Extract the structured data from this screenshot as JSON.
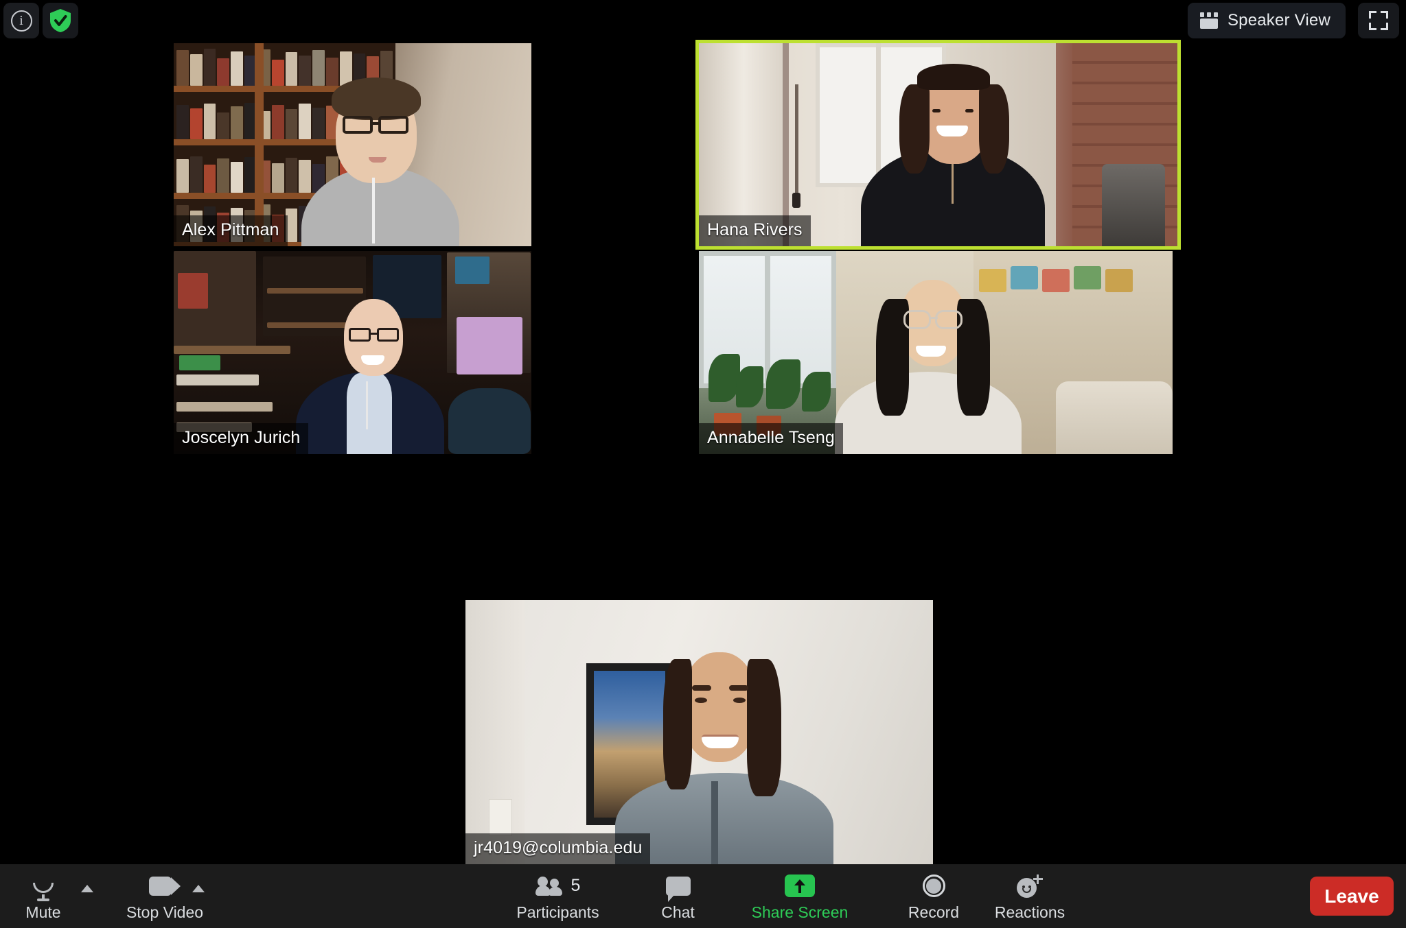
{
  "app": {
    "name": "Zoom Meeting",
    "background_color": "#000000",
    "toolbar_color": "#1c1c1c"
  },
  "topbar": {
    "info_icon": "info-icon",
    "info_glyph": "i",
    "encryption_icon": "shield-check-icon",
    "encryption_color": "#2ecc57",
    "view_button": {
      "label": "Speaker View",
      "icon": "grid-layout-icon"
    },
    "fullscreen_button": {
      "icon": "fullscreen-expand-icon",
      "label": ""
    }
  },
  "gallery": {
    "layout": "gallery-view",
    "active_speaker_border_color": "#bde031",
    "participants": [
      {
        "id": "alex",
        "name": "Alex Pittman",
        "active_speaker": false,
        "scene": "bookshelf office"
      },
      {
        "id": "hana",
        "name": "Hana Rivers",
        "active_speaker": true,
        "scene": "apartment window and brick wall"
      },
      {
        "id": "joscelyn",
        "name": "Joscelyn Jurich",
        "active_speaker": false,
        "scene": "cluttered home study"
      },
      {
        "id": "annabelle",
        "name": "Annabelle Tseng",
        "active_speaker": false,
        "scene": "window with houseplants"
      },
      {
        "id": "jr4019",
        "name": "jr4019@columbia.edu",
        "active_speaker": false,
        "scene": "white wall with framed picture"
      }
    ]
  },
  "toolbar": {
    "mute": {
      "label": "Mute",
      "icon": "microphone-icon",
      "has_menu": true,
      "menu_icon": "chevron-up-icon"
    },
    "video": {
      "label": "Stop Video",
      "icon": "camera-icon",
      "has_menu": true,
      "menu_icon": "chevron-up-icon"
    },
    "participants": {
      "label": "Participants",
      "icon": "people-icon",
      "count": "5"
    },
    "chat": {
      "label": "Chat",
      "icon": "chat-bubble-icon"
    },
    "share": {
      "label": "Share Screen",
      "icon": "share-screen-up-arrow-icon",
      "color": "#2ecc57"
    },
    "record": {
      "label": "Record",
      "icon": "record-circle-icon"
    },
    "reactions": {
      "label": "Reactions",
      "icon": "smiley-plus-icon"
    },
    "leave": {
      "label": "Leave",
      "color": "#cc2c26"
    }
  }
}
